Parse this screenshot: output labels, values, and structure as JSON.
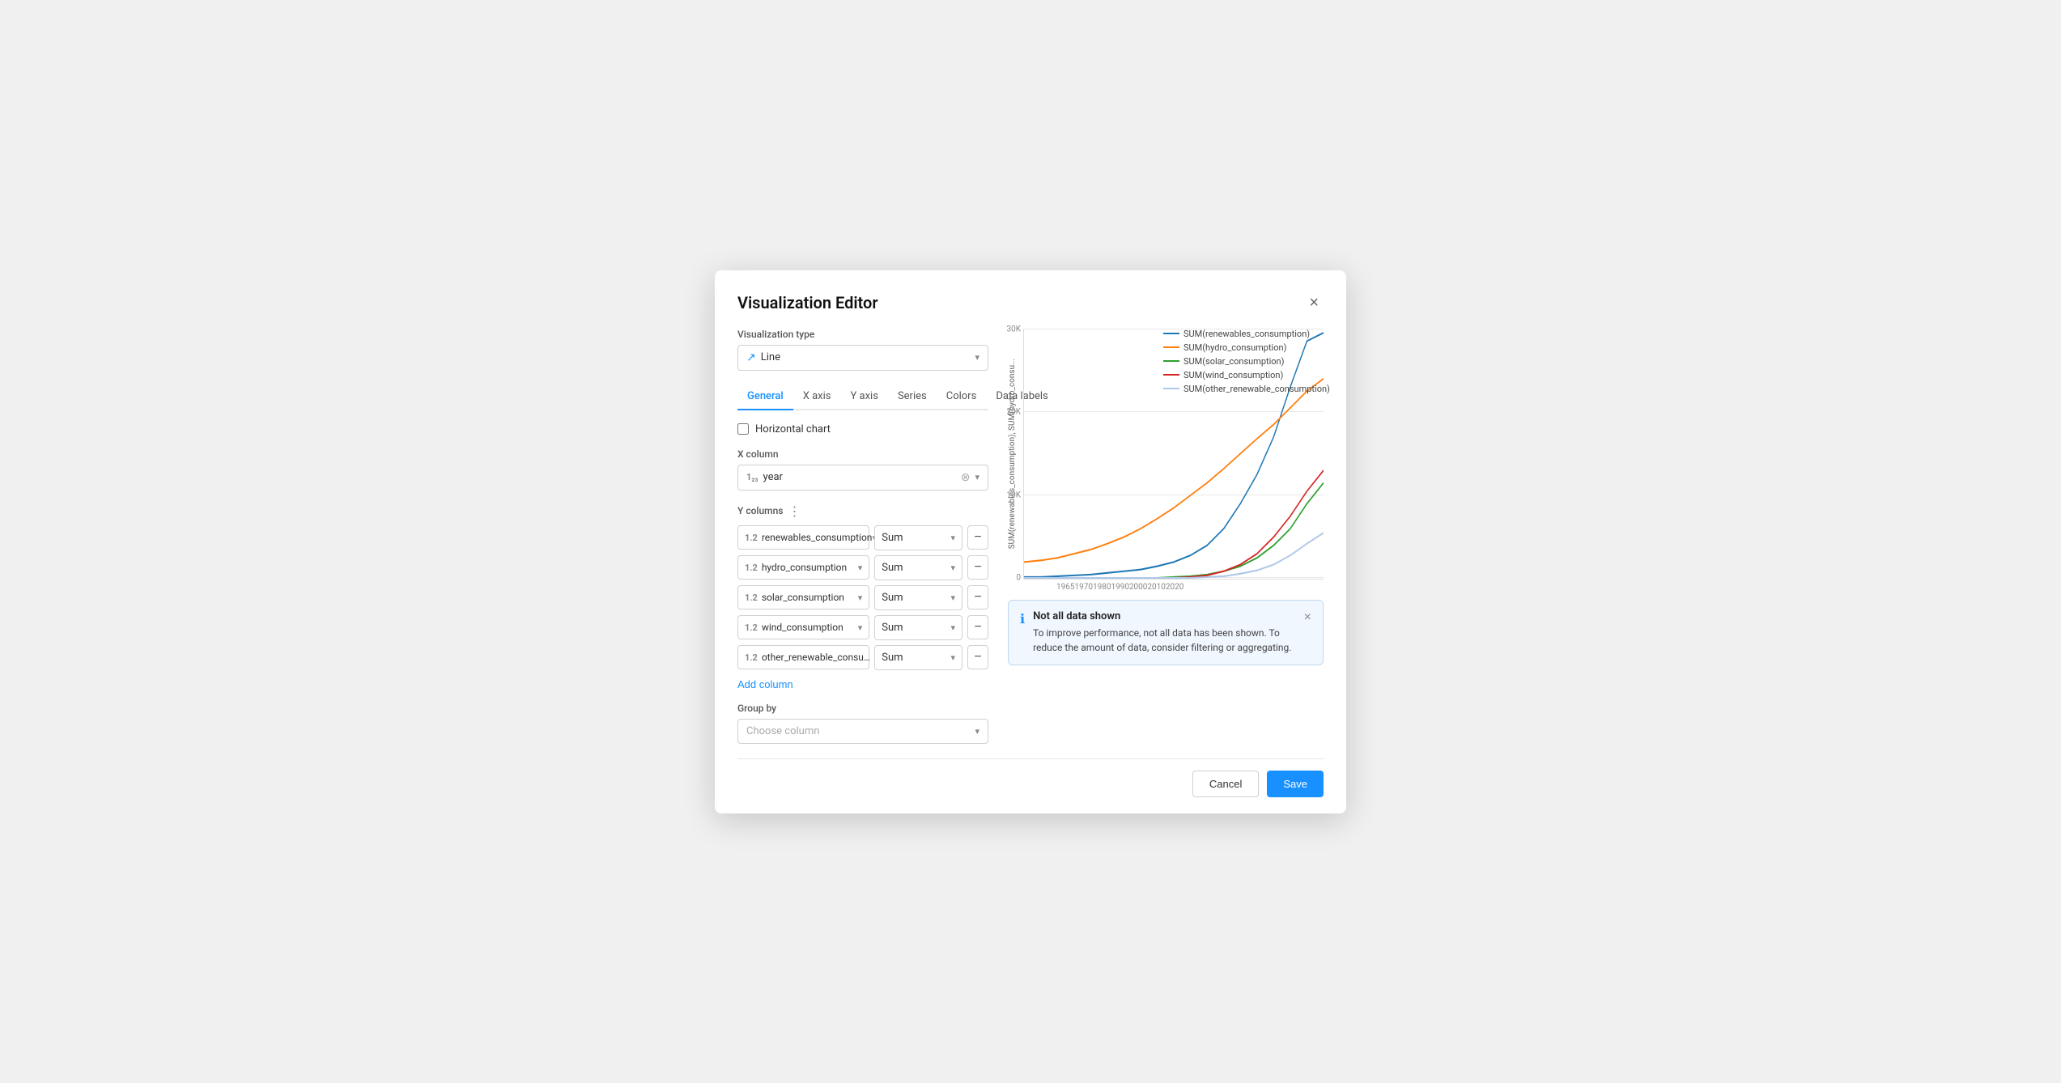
{
  "modal": {
    "title": "Visualization Editor",
    "close_label": "×"
  },
  "visualization_type": {
    "label": "Visualization type",
    "selected": "Line",
    "icon": "line-icon"
  },
  "tabs": [
    {
      "id": "general",
      "label": "General",
      "active": true
    },
    {
      "id": "x_axis",
      "label": "X axis",
      "active": false
    },
    {
      "id": "y_axis",
      "label": "Y axis",
      "active": false
    },
    {
      "id": "series",
      "label": "Series",
      "active": false
    },
    {
      "id": "colors",
      "label": "Colors",
      "active": false
    },
    {
      "id": "data_labels",
      "label": "Data labels",
      "active": false
    }
  ],
  "general": {
    "horizontal_chart_label": "Horizontal chart",
    "x_column_label": "X column",
    "x_column_value": "year",
    "y_columns_label": "Y columns",
    "y_columns": [
      {
        "col": "renewables_consumption",
        "agg": "Sum"
      },
      {
        "col": "hydro_consumption",
        "agg": "Sum"
      },
      {
        "col": "solar_consumption",
        "agg": "Sum"
      },
      {
        "col": "wind_consumption",
        "agg": "Sum"
      },
      {
        "col": "other_renewable_consumption",
        "agg": "Sum"
      }
    ],
    "add_column_label": "Add column",
    "group_by_label": "Group by",
    "group_by_placeholder": "Choose column"
  },
  "chart": {
    "y_axis_label": "SUM(renewables_consumption), SUM(hydro_consu...",
    "y_ticks": [
      "30K",
      "20K",
      "10K",
      "0"
    ],
    "x_ticks": [
      "1965",
      "1970",
      "1980",
      "1990",
      "2000",
      "2010",
      "2020"
    ],
    "legend": [
      {
        "label": "SUM(renewables_consumption)",
        "color": "#1f77b4"
      },
      {
        "label": "SUM(hydro_consumption)",
        "color": "#ff7f0e"
      },
      {
        "label": "SUM(solar_consumption)",
        "color": "#2ca02c"
      },
      {
        "label": "SUM(wind_consumption)",
        "color": "#d62728"
      },
      {
        "label": "SUM(other_renewable_consumption)",
        "color": "#aec7e8"
      }
    ]
  },
  "warning": {
    "title": "Not all data shown",
    "body": "To improve performance, not all data has been shown. To reduce the amount of data, consider filtering or aggregating.",
    "close_label": "×"
  },
  "footer": {
    "cancel_label": "Cancel",
    "save_label": "Save"
  }
}
